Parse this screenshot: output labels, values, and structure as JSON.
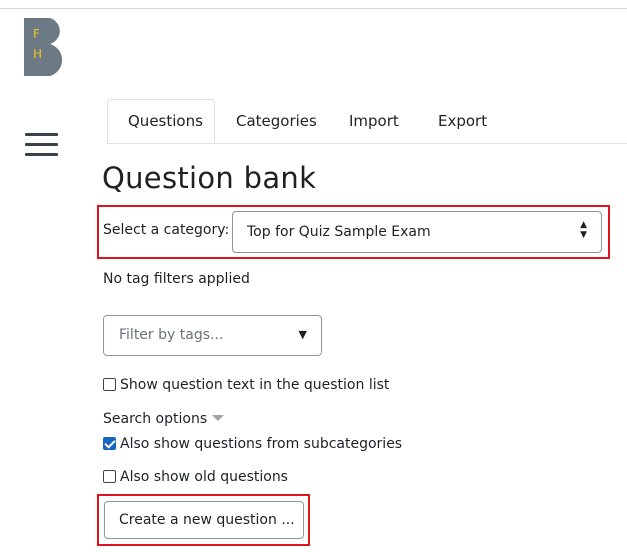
{
  "logo": {
    "letter_top": "F",
    "letter_bottom": "H"
  },
  "tabs": [
    {
      "label": "Questions",
      "active": true
    },
    {
      "label": "Categories"
    },
    {
      "label": "Import"
    },
    {
      "label": "Export"
    }
  ],
  "page_title": "Question bank",
  "category": {
    "label": "Select a category:",
    "selected": "Top for Quiz Sample Exam"
  },
  "tag_status": "No tag filters applied",
  "tag_filter": {
    "placeholder": "Filter by tags..."
  },
  "options": {
    "show_text": {
      "label": "Show question text in the question list",
      "checked": false
    },
    "search_options_label": "Search options",
    "subcategories": {
      "label": "Also show questions from subcategories",
      "checked": true
    },
    "old_questions": {
      "label": "Also show old questions",
      "checked": false
    }
  },
  "create_button": "Create a new question ...",
  "colors": {
    "highlight": "#e0131f",
    "logo_bg": "#6c7a86",
    "logo_text": "#f3c11b",
    "checkbox": "#1565c0"
  }
}
